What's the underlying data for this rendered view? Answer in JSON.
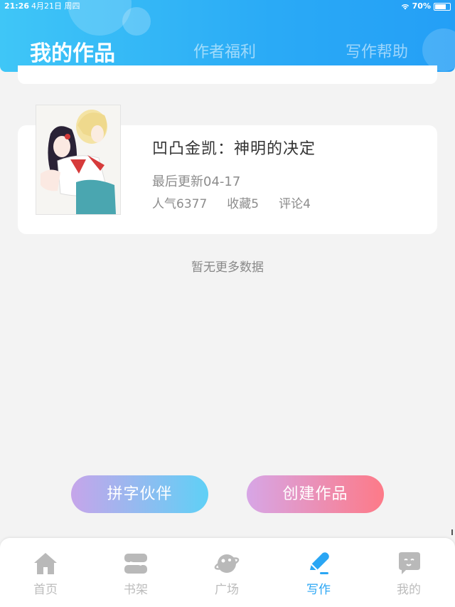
{
  "status_bar": {
    "time": "21:26",
    "date": "4月21日 周四",
    "battery": "70%"
  },
  "header": {
    "tabs": [
      {
        "label": "我的作品",
        "active": true
      },
      {
        "label": "作者福利",
        "active": false
      },
      {
        "label": "写作帮助",
        "active": false
      }
    ]
  },
  "work": {
    "title": "凹凸金凯：神明的决定",
    "updated": "最后更新04-17",
    "popularity": "人气6377",
    "favorites": "收藏5",
    "comments": "评论4"
  },
  "empty_hint": "暂无更多数据",
  "buttons": {
    "partner": "拼字伙伴",
    "create": "创建作品"
  },
  "bottom_nav": [
    {
      "label": "首页",
      "icon": "home-icon",
      "active": false
    },
    {
      "label": "书架",
      "icon": "bookshelf-icon",
      "active": false
    },
    {
      "label": "广场",
      "icon": "planet-icon",
      "active": false
    },
    {
      "label": "写作",
      "icon": "pen-icon",
      "active": true
    },
    {
      "label": "我的",
      "icon": "chat-icon",
      "active": false
    }
  ],
  "colors": {
    "accent": "#2aa6f4",
    "inactive": "#bcbcbc"
  }
}
